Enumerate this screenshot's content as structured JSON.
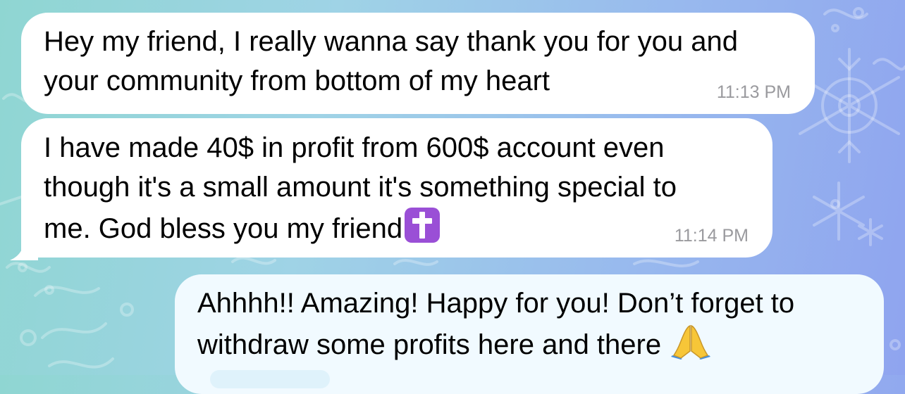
{
  "colors": {
    "incoming_bubble": "#ffffff",
    "outgoing_bubble": "#f1faff",
    "timestamp": "#9a9a9e",
    "wallpaper_left": "#8fd6d2",
    "wallpaper_right": "#8fa4ef"
  },
  "messages": [
    {
      "direction": "incoming",
      "lines": [
        "Hey my friend, I really wanna say thank you for you and",
        "your community from bottom of my heart"
      ],
      "time": "11:13 PM"
    },
    {
      "direction": "incoming",
      "lines": [
        "I have made 40$ in profit from 600$ account even",
        "though it's a small amount it's something special to",
        "me. God bless you my friend"
      ],
      "trailing_emoji": "latin-cross-emoji",
      "time": "11:14 PM"
    },
    {
      "direction": "outgoing",
      "lines": [
        "Ahhhh!! Amazing! Happy for you! Don’t forget to",
        "withdraw some profits here and there"
      ],
      "trailing_emoji": "folded-hands-emoji"
    }
  ]
}
